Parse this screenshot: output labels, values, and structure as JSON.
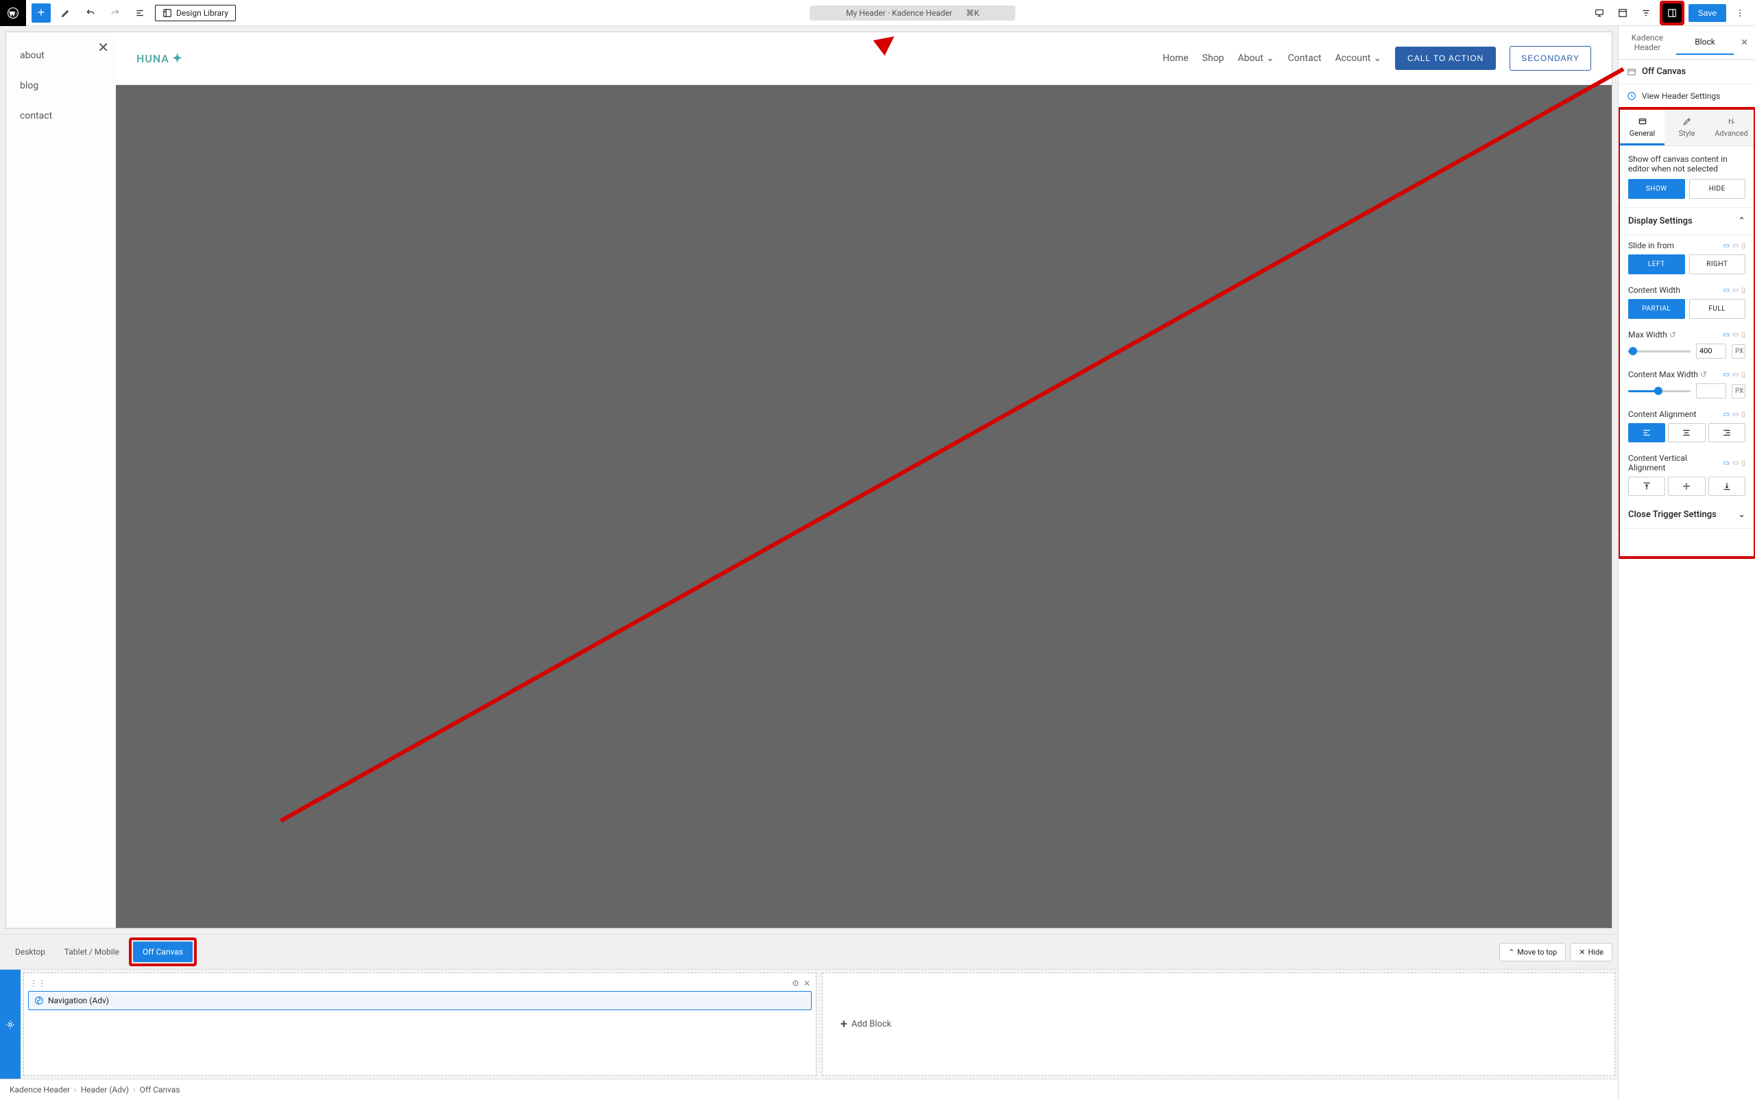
{
  "toolbar": {
    "design_library": "Design Library",
    "title": "My Header · Kadence Header",
    "shortcut": "⌘K",
    "save": "Save"
  },
  "offcanvas_panel": {
    "items": [
      "about",
      "blog",
      "contact"
    ]
  },
  "preview_header": {
    "logo_text": "HUNA",
    "nav": [
      "Home",
      "Shop",
      "About",
      "Contact",
      "Account"
    ],
    "cta_primary": "CALL TO ACTION",
    "cta_secondary": "SECONDARY"
  },
  "bottom_tabs": {
    "desktop": "Desktop",
    "tablet": "Tablet / Mobile",
    "offcanvas": "Off Canvas",
    "move_top": "Move to top",
    "hide": "Hide"
  },
  "block_area": {
    "nav_adv": "Navigation (Adv)",
    "add_block": "Add Block"
  },
  "breadcrumb": [
    "Kadence Header",
    "Header (Adv)",
    "Off Canvas"
  ],
  "sidebar": {
    "tab_header": "Kadence Header",
    "tab_block": "Block",
    "block_type": "Off Canvas",
    "view_header": "View Header Settings",
    "settings_tabs": {
      "general": "General",
      "style": "Style",
      "advanced": "Advanced"
    },
    "show_label": "Show off canvas content in editor when not selected",
    "show": "SHOW",
    "hide": "HIDE",
    "display_settings": "Display Settings",
    "slide_in": "Slide in from",
    "left": "LEFT",
    "right": "RIGHT",
    "content_width": "Content Width",
    "partial": "PARTIAL",
    "full": "FULL",
    "max_width": "Max Width",
    "max_width_val": "400",
    "content_max_width": "Content Max Width",
    "content_alignment": "Content Alignment",
    "content_valign": "Content Vertical Alignment",
    "close_trigger": "Close Trigger Settings",
    "px": "PX"
  }
}
